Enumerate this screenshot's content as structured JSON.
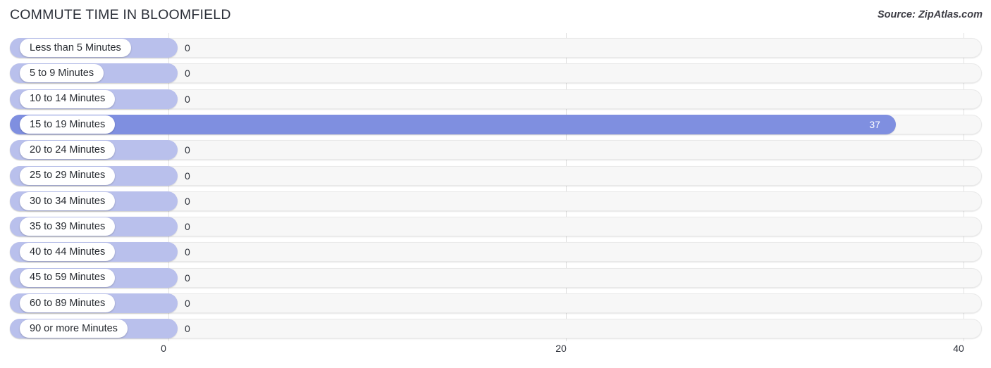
{
  "header": {
    "title": "COMMUTE TIME IN BLOOMFIELD",
    "source": "Source: ZipAtlas.com"
  },
  "colors": {
    "bar": "#b9c0ec",
    "bar_highlight": "#7f8fe0",
    "track": "#f7f7f7",
    "gridline": "#e2e2e2",
    "text": "#2b2f38"
  },
  "chart_data": {
    "type": "bar",
    "orientation": "horizontal",
    "title": "COMMUTE TIME IN BLOOMFIELD",
    "xlabel": "",
    "ylabel": "",
    "xlim": [
      0,
      40
    ],
    "grid": true,
    "legend": null,
    "tick_labels": [
      "0",
      "20",
      "40"
    ],
    "tick_values": [
      0,
      20,
      40
    ],
    "categories": [
      "Less than 5 Minutes",
      "5 to 9 Minutes",
      "10 to 14 Minutes",
      "15 to 19 Minutes",
      "20 to 24 Minutes",
      "25 to 29 Minutes",
      "30 to 34 Minutes",
      "35 to 39 Minutes",
      "40 to 44 Minutes",
      "45 to 59 Minutes",
      "60 to 89 Minutes",
      "90 or more Minutes"
    ],
    "values": [
      0,
      0,
      0,
      37,
      0,
      0,
      0,
      0,
      0,
      0,
      0,
      0
    ],
    "value_labels": [
      "0",
      "0",
      "0",
      "37",
      "0",
      "0",
      "0",
      "0",
      "0",
      "0",
      "0",
      "0"
    ],
    "highlight_index": 3
  }
}
